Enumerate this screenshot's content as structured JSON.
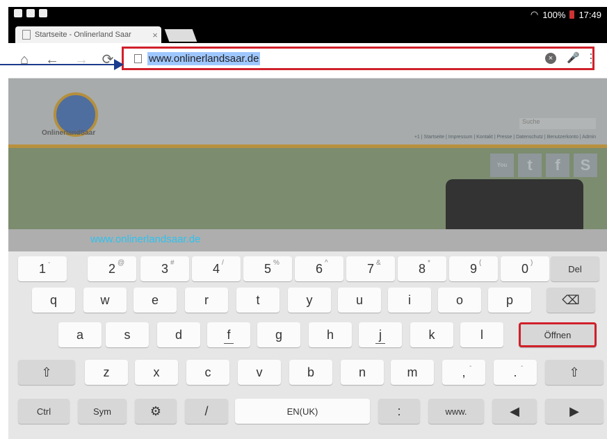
{
  "status_bar": {
    "battery": "100%",
    "time": "17:49"
  },
  "tab": {
    "title": "Startseite - Onlinerland Saar",
    "close": "×"
  },
  "toolbar": {
    "home": "⌂",
    "back": "←",
    "forward": "→",
    "reload": "⟳",
    "url": "www.onlinerlandsaar.de",
    "clear": "×",
    "menu": "⋮"
  },
  "webpage": {
    "brand": "OnlinerlandSaar",
    "search_placeholder": "Suche",
    "nav_links": "+1 | Startseite | Impressum | Kontakt | Presse | Datenschutz | Benutzerkonto | Admin",
    "social": [
      "You Tube",
      "t",
      "f",
      "S"
    ]
  },
  "suggestion": "www.onlinerlandsaar.de",
  "keyboard": {
    "rows": [
      [
        {
          "k": "1",
          "s": "-"
        },
        {
          "k": "2",
          "s": "@"
        },
        {
          "k": "3",
          "s": "#"
        },
        {
          "k": "4",
          "s": "/"
        },
        {
          "k": "5",
          "s": "%"
        },
        {
          "k": "6",
          "s": "^"
        },
        {
          "k": "7",
          "s": "&"
        },
        {
          "k": "8",
          "s": "*"
        },
        {
          "k": "9",
          "s": "("
        },
        {
          "k": "0",
          "s": ")"
        },
        {
          "k": "Del",
          "s": ""
        }
      ],
      [
        {
          "k": "q"
        },
        {
          "k": "w"
        },
        {
          "k": "e"
        },
        {
          "k": "r"
        },
        {
          "k": "t"
        },
        {
          "k": "y"
        },
        {
          "k": "u"
        },
        {
          "k": "i"
        },
        {
          "k": "o"
        },
        {
          "k": "p"
        },
        {
          "k": "⌫"
        }
      ],
      [
        {
          "k": "a"
        },
        {
          "k": "s"
        },
        {
          "k": "d"
        },
        {
          "k": "f"
        },
        {
          "k": "g"
        },
        {
          "k": "h"
        },
        {
          "k": "j"
        },
        {
          "k": "k"
        },
        {
          "k": "l"
        },
        {
          "k": "Öffnen"
        }
      ],
      [
        {
          "k": "⇧"
        },
        {
          "k": "z"
        },
        {
          "k": "x"
        },
        {
          "k": "c"
        },
        {
          "k": "v"
        },
        {
          "k": "b"
        },
        {
          "k": "n"
        },
        {
          "k": "m"
        },
        {
          "k": ",",
          "s": "-"
        },
        {
          "k": ".",
          "s": "-"
        },
        {
          "k": "⇧"
        }
      ],
      [
        {
          "k": "Ctrl"
        },
        {
          "k": "Sym"
        },
        {
          "k": "⚙"
        },
        {
          "k": "/"
        },
        {
          "k": "EN(UK)"
        },
        {
          "k": ":"
        },
        {
          "k": "www."
        },
        {
          "k": "◀"
        },
        {
          "k": "▶"
        }
      ]
    ]
  }
}
